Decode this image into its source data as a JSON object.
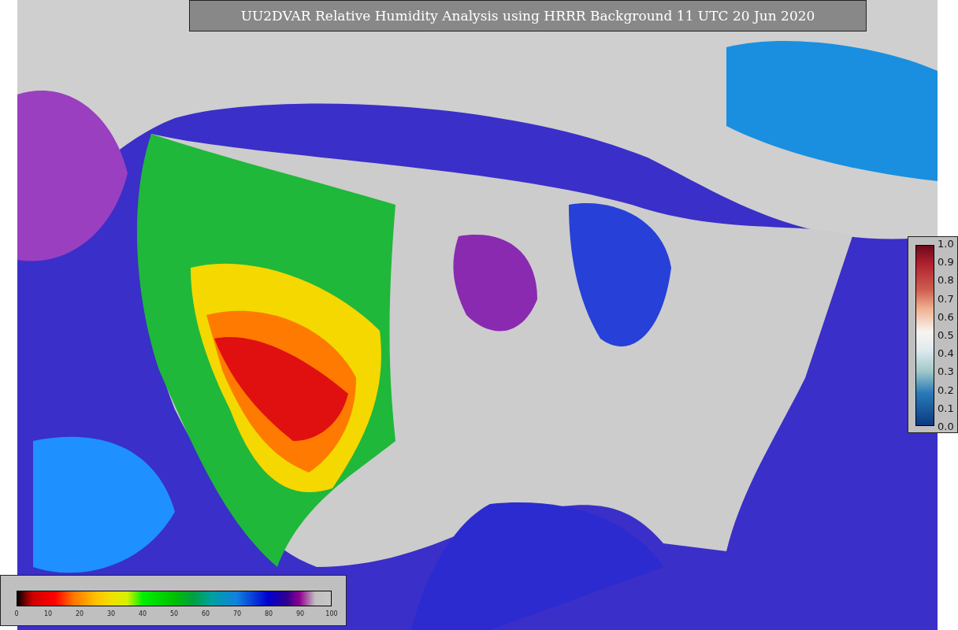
{
  "title": "UU2DVAR Relative Humidity Analysis using HRRR Background 11 UTC 20 Jun 2020",
  "humidity_colorbar": {
    "ticks": [
      "0",
      "10",
      "20",
      "30",
      "40",
      "50",
      "60",
      "70",
      "80",
      "90",
      "100"
    ]
  },
  "ratio_colorbar": {
    "ticks": [
      "1.0",
      "0.9",
      "0.8",
      "0.7",
      "0.6",
      "0.5",
      "0.4",
      "0.3",
      "0.2",
      "0.1",
      "0.0"
    ]
  }
}
